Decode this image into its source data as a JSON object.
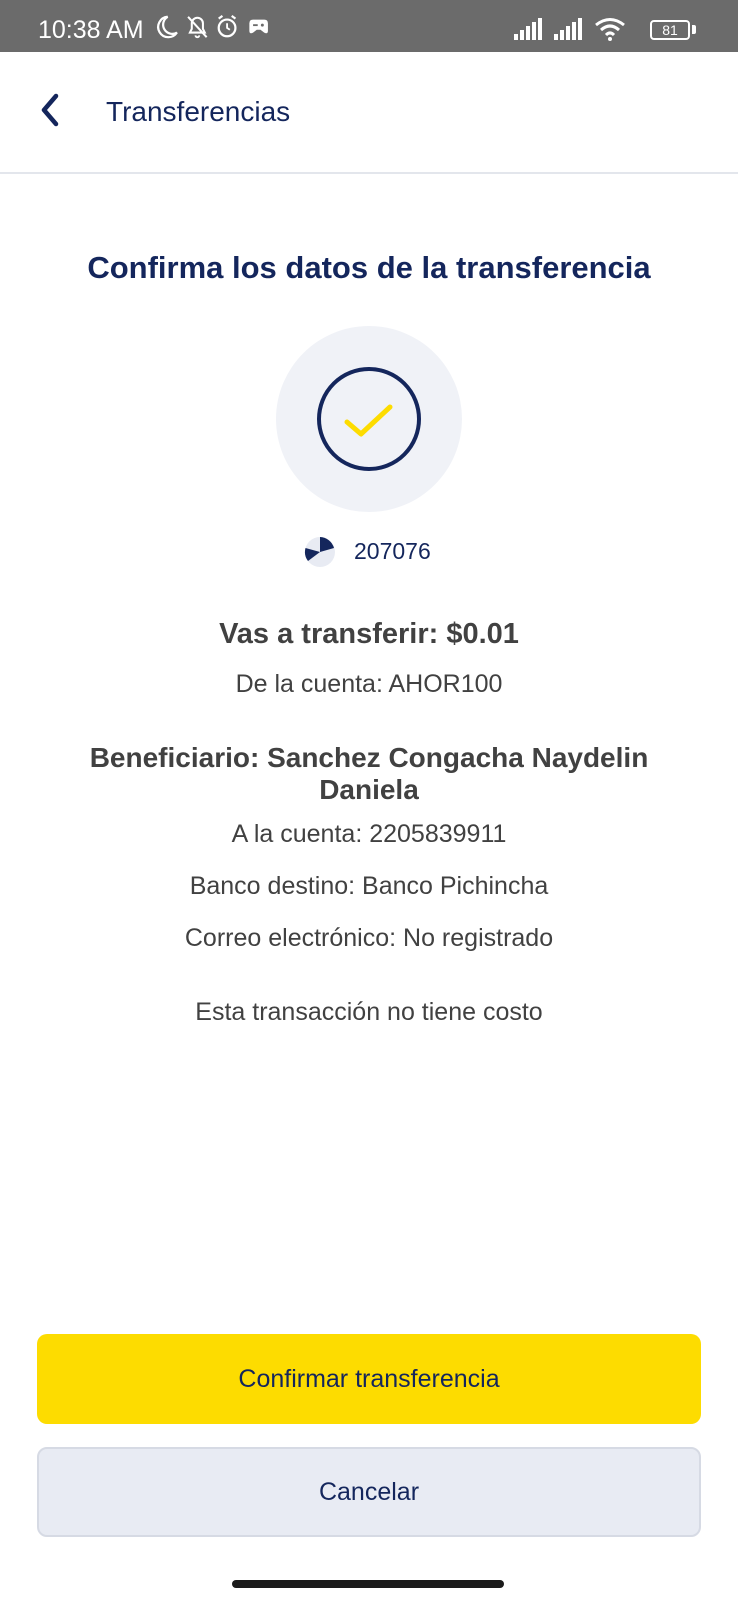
{
  "status_bar": {
    "time": "10:38 AM",
    "battery": "81",
    "icons_left": [
      "moon-icon",
      "bell-off-icon",
      "alarm-icon",
      "game-controller-icon"
    ],
    "icons_right": [
      "signal-icon",
      "signal-icon",
      "wifi-icon",
      "battery-icon"
    ]
  },
  "app_bar": {
    "title": "Transferencias",
    "back_icon": "chevron-left-icon"
  },
  "main": {
    "heading": "Confirma los datos de la transferencia",
    "success_icon": "checkmark-icon",
    "timer_icon": "pie-timer-icon",
    "code": "207076",
    "amount_text": "Vas a transferir: $0.01",
    "from_account": "De la cuenta: AHOR100",
    "beneficiary": "Beneficiario: Sanchez  Congacha Naydelin Daniela",
    "to_account": "A la cuenta: 2205839911",
    "bank": "Banco destino: Banco Pichincha",
    "email": "Correo electrónico: No registrado",
    "cost_note": "Esta transacción no tiene costo"
  },
  "actions": {
    "confirm_label": "Confirmar transferencia",
    "cancel_label": "Cancelar"
  },
  "colors": {
    "primary_navy": "#14265c",
    "accent_yellow": "#fddc00",
    "text_gray": "#414141",
    "secondary_button": "#e8ebf3",
    "status_bar": "#6b6b6b"
  }
}
